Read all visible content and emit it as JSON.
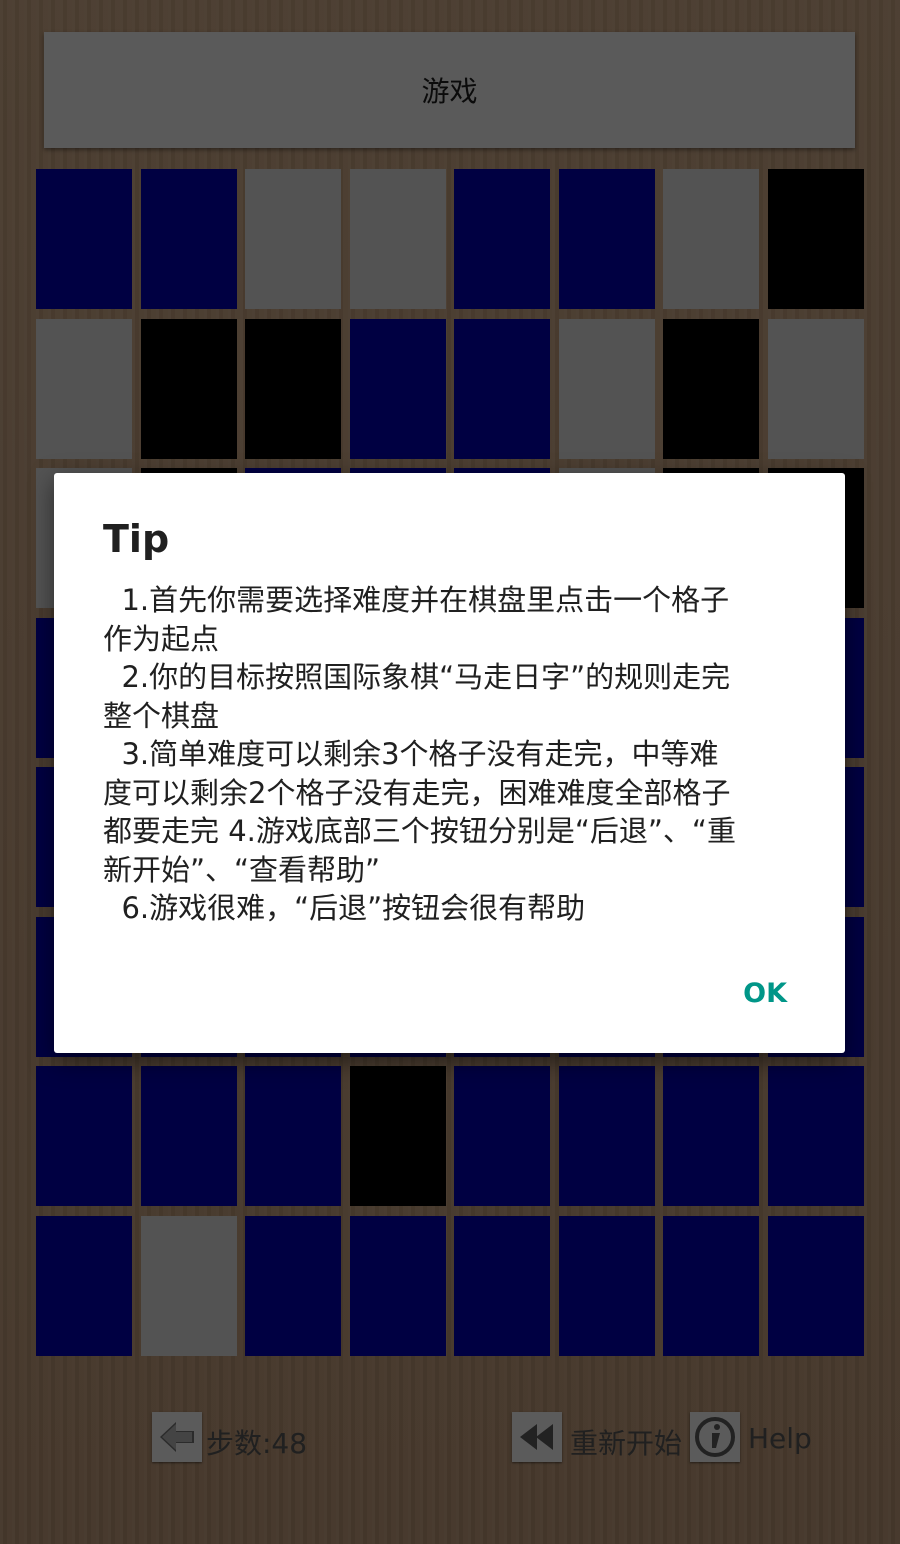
{
  "header": {
    "title": "游戏"
  },
  "colors": {
    "blue": "#000066",
    "gray": "#808080",
    "black": "#000000"
  },
  "board": {
    "rows": [
      [
        "blue",
        "blue",
        "gray",
        "gray",
        "blue",
        "blue",
        "gray",
        "black"
      ],
      [
        "gray",
        "black",
        "black",
        "blue",
        "blue",
        "gray",
        "black",
        "gray"
      ],
      [
        "gray",
        "black",
        "blue",
        "blue",
        "blue",
        "gray",
        "black",
        "black"
      ],
      [
        "blue",
        "blue",
        "blue",
        "blue",
        "blue",
        "blue",
        "blue",
        "blue"
      ],
      [
        "blue",
        "blue",
        "blue",
        "blue",
        "blue",
        "blue",
        "blue",
        "blue"
      ],
      [
        "blue",
        "blue",
        "blue",
        "blue",
        "blue",
        "blue",
        "blue",
        "blue"
      ],
      [
        "blue",
        "blue",
        "blue",
        "black",
        "blue",
        "blue",
        "blue",
        "blue"
      ],
      [
        "blue",
        "gray",
        "blue",
        "blue",
        "blue",
        "blue",
        "blue",
        "blue"
      ]
    ]
  },
  "dialog": {
    "title": "Tip",
    "lines": [
      "  1.首先你需要选择难度并在棋盘里点击一个格子",
      "作为起点",
      "  2.你的目标按照国际象棋“马走日字”的规则走完",
      "整个棋盘",
      "  3.简单难度可以剩余3个格子没有走完，中等难",
      "度可以剩余2个格子没有走完，困难难度全部格子",
      "都要走完 4.游戏底部三个按钮分别是“后退”、“重",
      "新开始”、“查看帮助”",
      "  6.游戏很难，“后退”按钮会很有帮助"
    ],
    "ok_label": "OK"
  },
  "bottom": {
    "steps_label": "步数:48",
    "restart_label": "重新开始",
    "help_label": "Help",
    "icons": {
      "back": "left-arrow-icon",
      "restart": "rewind-icon",
      "help": "info-icon"
    }
  }
}
